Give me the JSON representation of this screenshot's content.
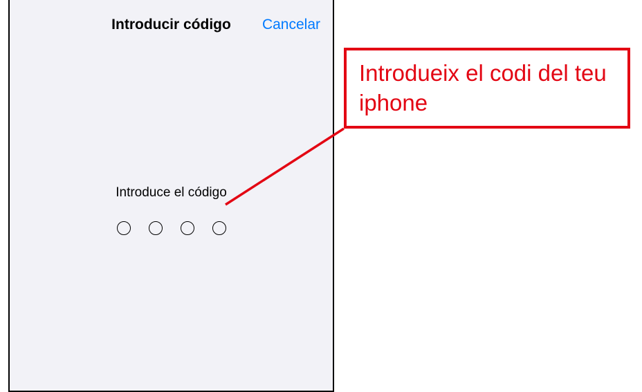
{
  "sheet": {
    "title": "Introducir código",
    "cancel_label": "Cancelar",
    "prompt": "Introduce el código",
    "passcode_length": 4
  },
  "annotation": {
    "text": "Introdueix el codi del teu iphone",
    "color": "#e30613"
  }
}
